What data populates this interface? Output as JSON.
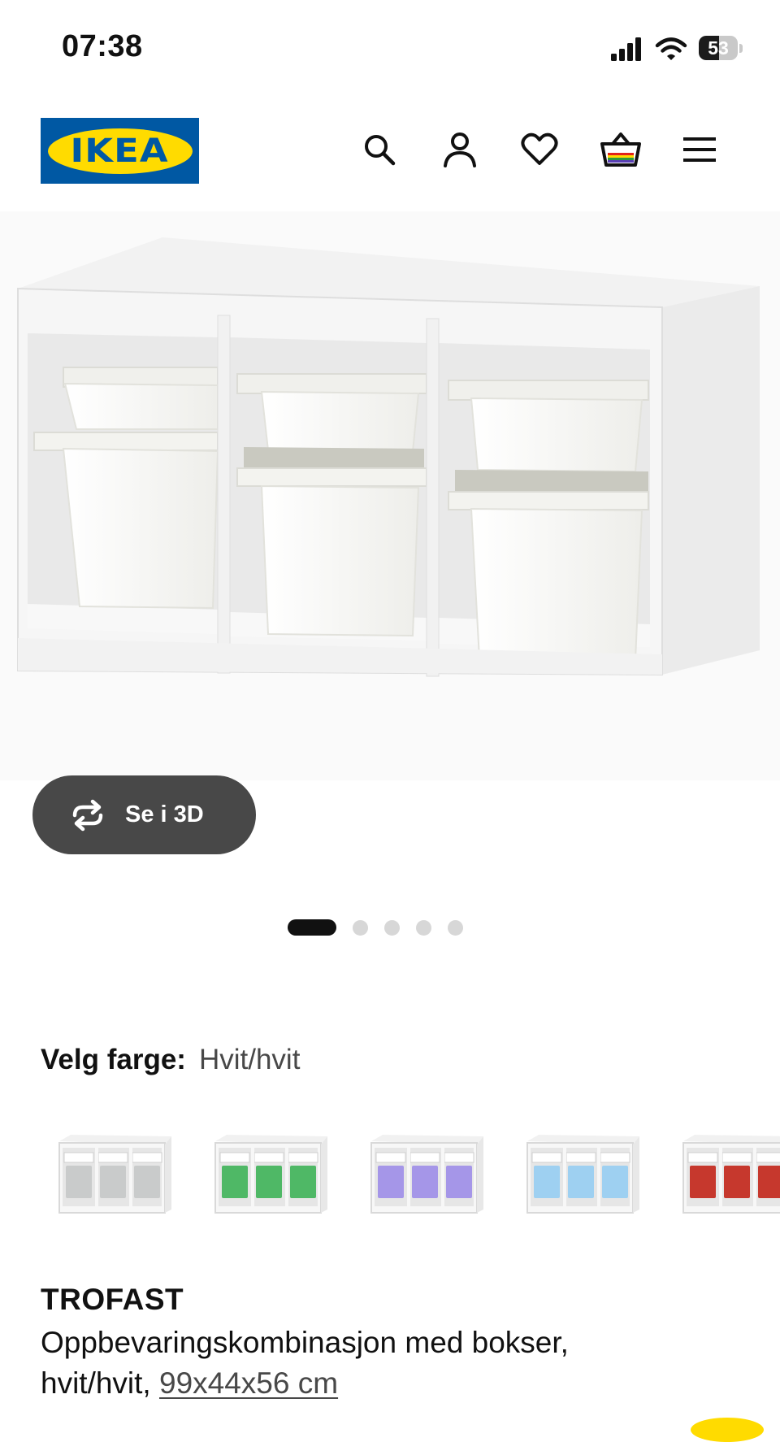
{
  "status_bar": {
    "time": "07:38",
    "battery_level": "53",
    "battery_fraction": 0.53
  },
  "header": {
    "logo_text": "IKEA",
    "icons": [
      "search-icon",
      "account-icon",
      "wishlist-heart-icon",
      "shopping-basket-icon",
      "menu-icon"
    ]
  },
  "gallery": {
    "view3d_label": "Se i 3D",
    "slide_count": 5,
    "active_slide": 1
  },
  "color_picker": {
    "label": "Velg farge:",
    "selected": "Hvit/hvit",
    "swatches": [
      {
        "name": "grey",
        "bin_color": "#c9cbcb"
      },
      {
        "name": "green",
        "bin_color": "#4fb866"
      },
      {
        "name": "lilac",
        "bin_color": "#a596e8"
      },
      {
        "name": "light-blue",
        "bin_color": "#9ed0f1"
      },
      {
        "name": "red",
        "bin_color": "#c6382d"
      }
    ]
  },
  "product": {
    "name": "TROFAST",
    "description": "Oppbevaringskombinasjon med bokser,",
    "description_line2": "hvit/hvit,",
    "size": "99x44x56 cm"
  },
  "colors": {
    "ikea_blue": "#0058a3",
    "ikea_yellow": "#ffdb00",
    "button_dark": "#484848"
  }
}
